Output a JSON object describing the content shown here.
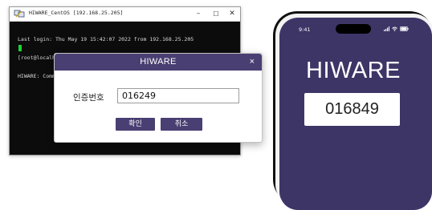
{
  "terminal": {
    "title": "HIWARE_CentOS [192.168.25.205]",
    "window_controls": {
      "minimize": "–",
      "maximize": "☐",
      "close": "✕"
    },
    "lines": [
      "Last login: Thu May 19 15:42:07 2022 from 192.168.25.205",
      "[root@localhost ~]# top",
      "HIWARE: Command verification processing"
    ]
  },
  "dialog": {
    "title": "HIWARE",
    "close": "×",
    "code_label": "인증번호",
    "code_value": "016249",
    "ok_label": "확인",
    "cancel_label": "취소"
  },
  "phone": {
    "status_time": "9:41",
    "brand": "HIWARE",
    "otp_code": "016849"
  },
  "colors": {
    "accent": "#4a3f72",
    "phone_screen": "#3d3566",
    "cursor": "#1fd32f"
  }
}
